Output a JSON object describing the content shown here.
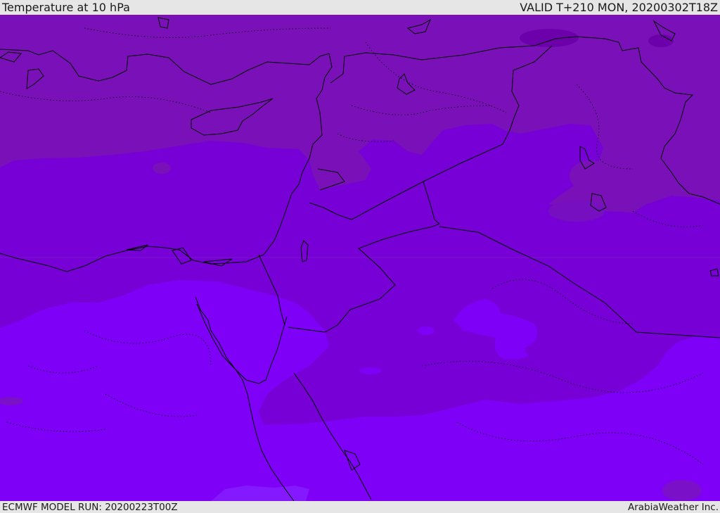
{
  "header": {
    "title": "Temperature at 10 hPa",
    "valid_time": "VALID T+210 MON, 20200302T18Z"
  },
  "footer": {
    "model_run": "ECMWF MODEL RUN: 20200223T00Z",
    "credit": "ArabiaWeather Inc."
  },
  "map": {
    "region": "Eastern Mediterranean and Middle East",
    "field": "10 hPa temperature filled contours",
    "colors": {
      "band_coldest": "#6600aa",
      "band_cold": "#7a10b8",
      "band_mid": "#7600d6",
      "band_warm": "#7e00f7",
      "band_warmest": "#8a18ff",
      "borders": "#000000"
    }
  }
}
